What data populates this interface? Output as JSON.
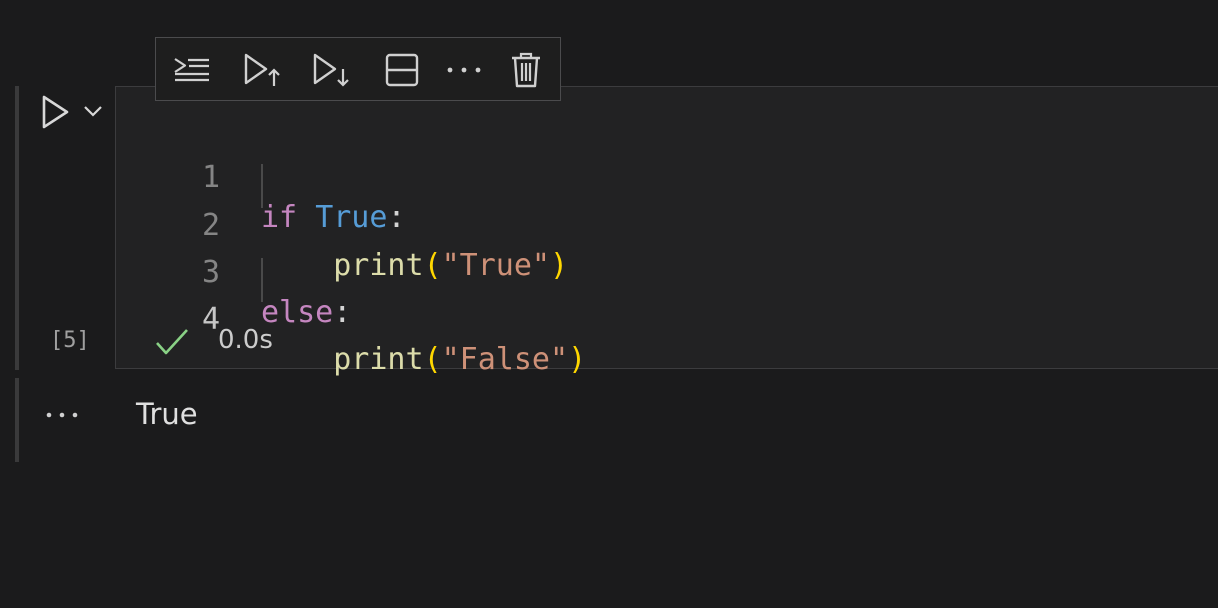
{
  "toolbar": {
    "items": [
      {
        "name": "execute-above-cells-icon",
        "label": "Execute above cells"
      },
      {
        "name": "execute-above-icon",
        "label": "Execute cell and above"
      },
      {
        "name": "execute-below-icon",
        "label": "Execute cell and below"
      },
      {
        "name": "split-cell-icon",
        "label": "Split cell"
      },
      {
        "name": "more-actions-icon",
        "label": "More actions"
      },
      {
        "name": "trash-icon",
        "label": "Delete cell"
      }
    ]
  },
  "cell": {
    "run_icon": "play-icon",
    "run_menu_icon": "chevron-down-icon",
    "execution_count": "[5]",
    "status_icon": "check-icon",
    "duration": "0.0s",
    "lines": [
      {
        "number": "1",
        "tokens": [
          [
            "kw",
            "if"
          ],
          [
            "plain",
            " "
          ],
          [
            "const",
            "True"
          ],
          [
            "punc",
            ":"
          ]
        ]
      },
      {
        "number": "2",
        "tokens": [
          [
            "plain",
            "    "
          ],
          [
            "fn",
            "print"
          ],
          [
            "paren",
            "("
          ],
          [
            "str",
            "\"True\""
          ],
          [
            "paren",
            ")"
          ]
        ]
      },
      {
        "number": "3",
        "tokens": [
          [
            "kw",
            "else"
          ],
          [
            "punc",
            ":"
          ]
        ]
      },
      {
        "number": "4",
        "tokens": [
          [
            "plain",
            "    "
          ],
          [
            "fn",
            "print"
          ],
          [
            "paren",
            "("
          ],
          [
            "str",
            "\"False\""
          ],
          [
            "paren",
            ")"
          ]
        ]
      }
    ],
    "active_line": "4"
  },
  "output": {
    "more_icon": "ellipsis-icon",
    "text": "True"
  },
  "colors": {
    "background": "#1b1b1c",
    "editor": "#222223",
    "keyword": "#c586c0",
    "constant": "#569cd6",
    "function": "#dcdcaa",
    "bracket": "#ffd700",
    "string": "#ce9178",
    "success": "#89d185"
  }
}
